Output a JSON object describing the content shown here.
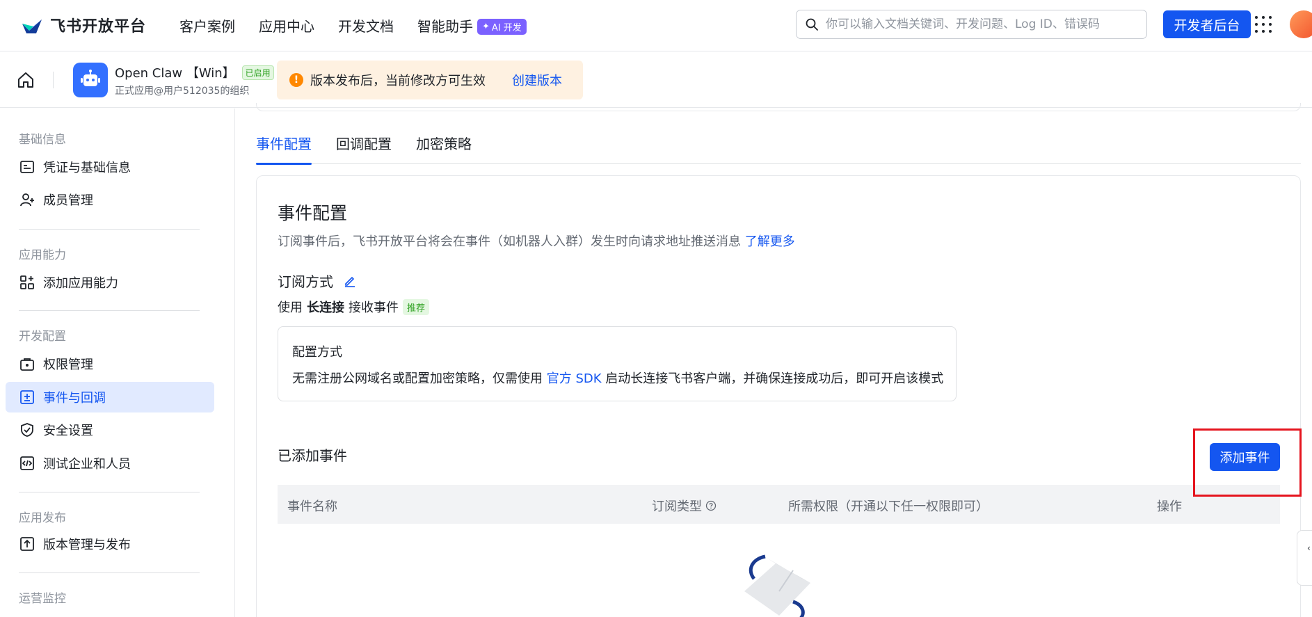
{
  "topbar": {
    "brand": "飞书开放平台",
    "nav": [
      {
        "label": "客户案例"
      },
      {
        "label": "应用中心"
      },
      {
        "label": "开发文档"
      },
      {
        "label": "智能助手"
      }
    ],
    "ai_badge": "AI 开发",
    "search_placeholder": "你可以输入文档关键词、开发问题、Log ID、错误码",
    "dev_button": "开发者后台",
    "icons": [
      "search-icon",
      "apps-grid-icon",
      "user-avatar"
    ]
  },
  "appbar": {
    "app_name": "Open Claw 【Win】",
    "status_badge": "已启用",
    "org": "正式应用@用户512035的组织",
    "notice_text": "版本发布后，当前修改方可生效",
    "notice_link": "创建版本"
  },
  "sidebar": {
    "sections": [
      {
        "title": "基础信息",
        "items": [
          {
            "label": "凭证与基础信息",
            "icon": "credential-icon"
          },
          {
            "label": "成员管理",
            "icon": "member-add-icon"
          }
        ]
      },
      {
        "title": "应用能力",
        "items": [
          {
            "label": "添加应用能力",
            "icon": "app-capability-icon"
          }
        ]
      },
      {
        "title": "开发配置",
        "items": [
          {
            "label": "权限管理",
            "icon": "permission-icon"
          },
          {
            "label": "事件与回调",
            "icon": "event-callback-icon",
            "active": true
          },
          {
            "label": "安全设置",
            "icon": "shield-icon"
          },
          {
            "label": "测试企业和人员",
            "icon": "code-test-icon"
          }
        ]
      },
      {
        "title": "应用发布",
        "items": [
          {
            "label": "版本管理与发布",
            "icon": "upload-icon"
          }
        ]
      },
      {
        "title": "运营监控",
        "items": []
      }
    ]
  },
  "tabs": [
    {
      "label": "事件配置",
      "active": true
    },
    {
      "label": "回调配置"
    },
    {
      "label": "加密策略"
    }
  ],
  "event_config": {
    "title": "事件配置",
    "desc": "订阅事件后，飞书开放平台将会在事件（如机器人入群）发生时向请求地址推送消息",
    "learn_more": "了解更多",
    "subscribe_label": "订阅方式",
    "use_prefix": "使用",
    "use_method": "长连接",
    "use_suffix": "接收事件",
    "recommended": "推荐",
    "method_box_title": "配置方式",
    "method_desc_before": "无需注册公网域名或配置加密策略，仅需使用",
    "method_desc_link": "官方 SDK",
    "method_desc_after": "启动长连接飞书客户端，并确保连接成功后，即可开启该模式",
    "added_title": "已添加事件",
    "add_button": "添加事件",
    "columns": [
      "事件名称",
      "订阅类型",
      "所需权限（开通以下任一权限即可）",
      "操作"
    ]
  },
  "colors": {
    "primary": "#1456f0",
    "highlight": "#e5141e",
    "notice_bg": "#fef1e1"
  }
}
